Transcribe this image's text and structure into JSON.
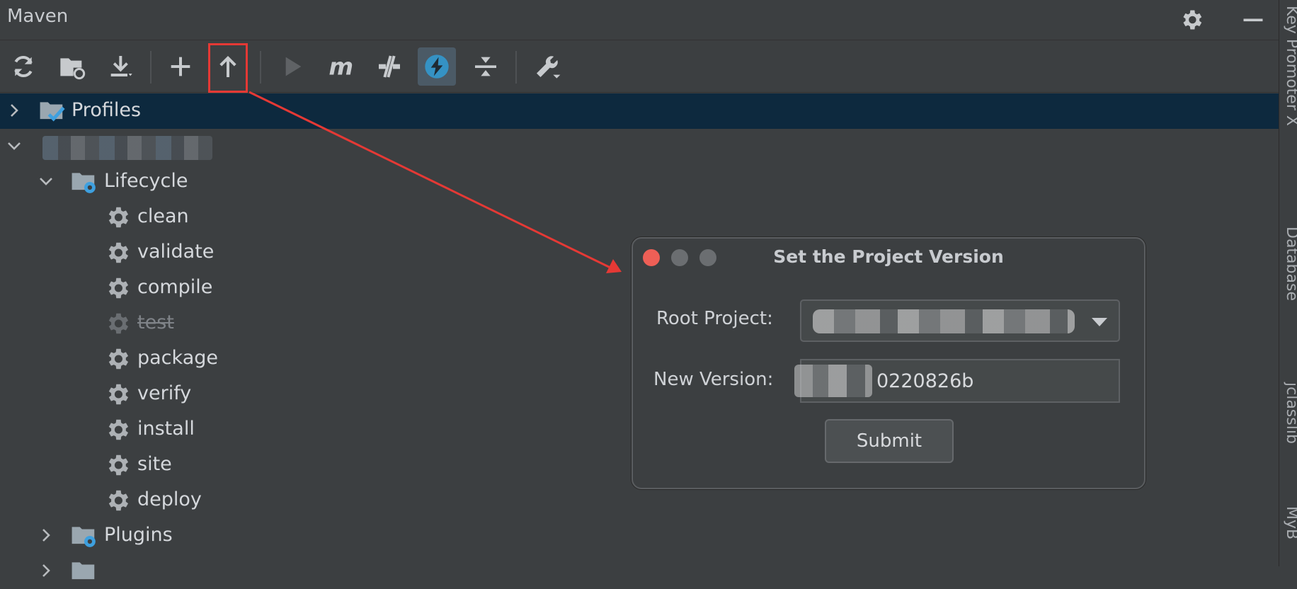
{
  "panel": {
    "title": "Maven",
    "header_icons": [
      "gear-icon",
      "minimize-icon"
    ]
  },
  "toolbar": {
    "buttons": [
      {
        "name": "reload-all-projects",
        "icon": "refresh-icon"
      },
      {
        "name": "reload-project",
        "icon": "folder-refresh-icon"
      },
      {
        "name": "download-sources",
        "icon": "download-icon"
      },
      {
        "name": "add-maven-project",
        "icon": "plus-icon"
      },
      {
        "name": "set-project-version",
        "icon": "arrow-up-icon",
        "highlighted": true
      },
      {
        "name": "run-maven-build",
        "icon": "play-icon",
        "disabled": true
      },
      {
        "name": "execute-maven-goal",
        "icon": "maven-m-icon"
      },
      {
        "name": "toggle-offline-mode",
        "icon": "offline-icon"
      },
      {
        "name": "skip-tests",
        "icon": "lightning-icon",
        "active": true
      },
      {
        "name": "collapse-all",
        "icon": "collapse-icon"
      },
      {
        "name": "maven-settings",
        "icon": "wrench-icon"
      }
    ]
  },
  "tree": {
    "profiles": "Profiles",
    "lifecycle": "Lifecycle",
    "goals": [
      "clean",
      "validate",
      "compile",
      "test",
      "package",
      "verify",
      "install",
      "site",
      "deploy"
    ],
    "plugins": "Plugins"
  },
  "right_sidebar": {
    "tabs": [
      "Key Promoter X",
      "Database",
      "jclasslib",
      "MyB"
    ]
  },
  "dialog": {
    "title": "Set the Project Version",
    "root_project_label": "Root Project:",
    "new_version_label": "New Version:",
    "new_version_value": "0220826b",
    "submit_label": "Submit"
  },
  "colors": {
    "background": "#3c3f41",
    "selection": "#0d293e",
    "accent": "#3592c4",
    "highlight": "#e53935"
  }
}
